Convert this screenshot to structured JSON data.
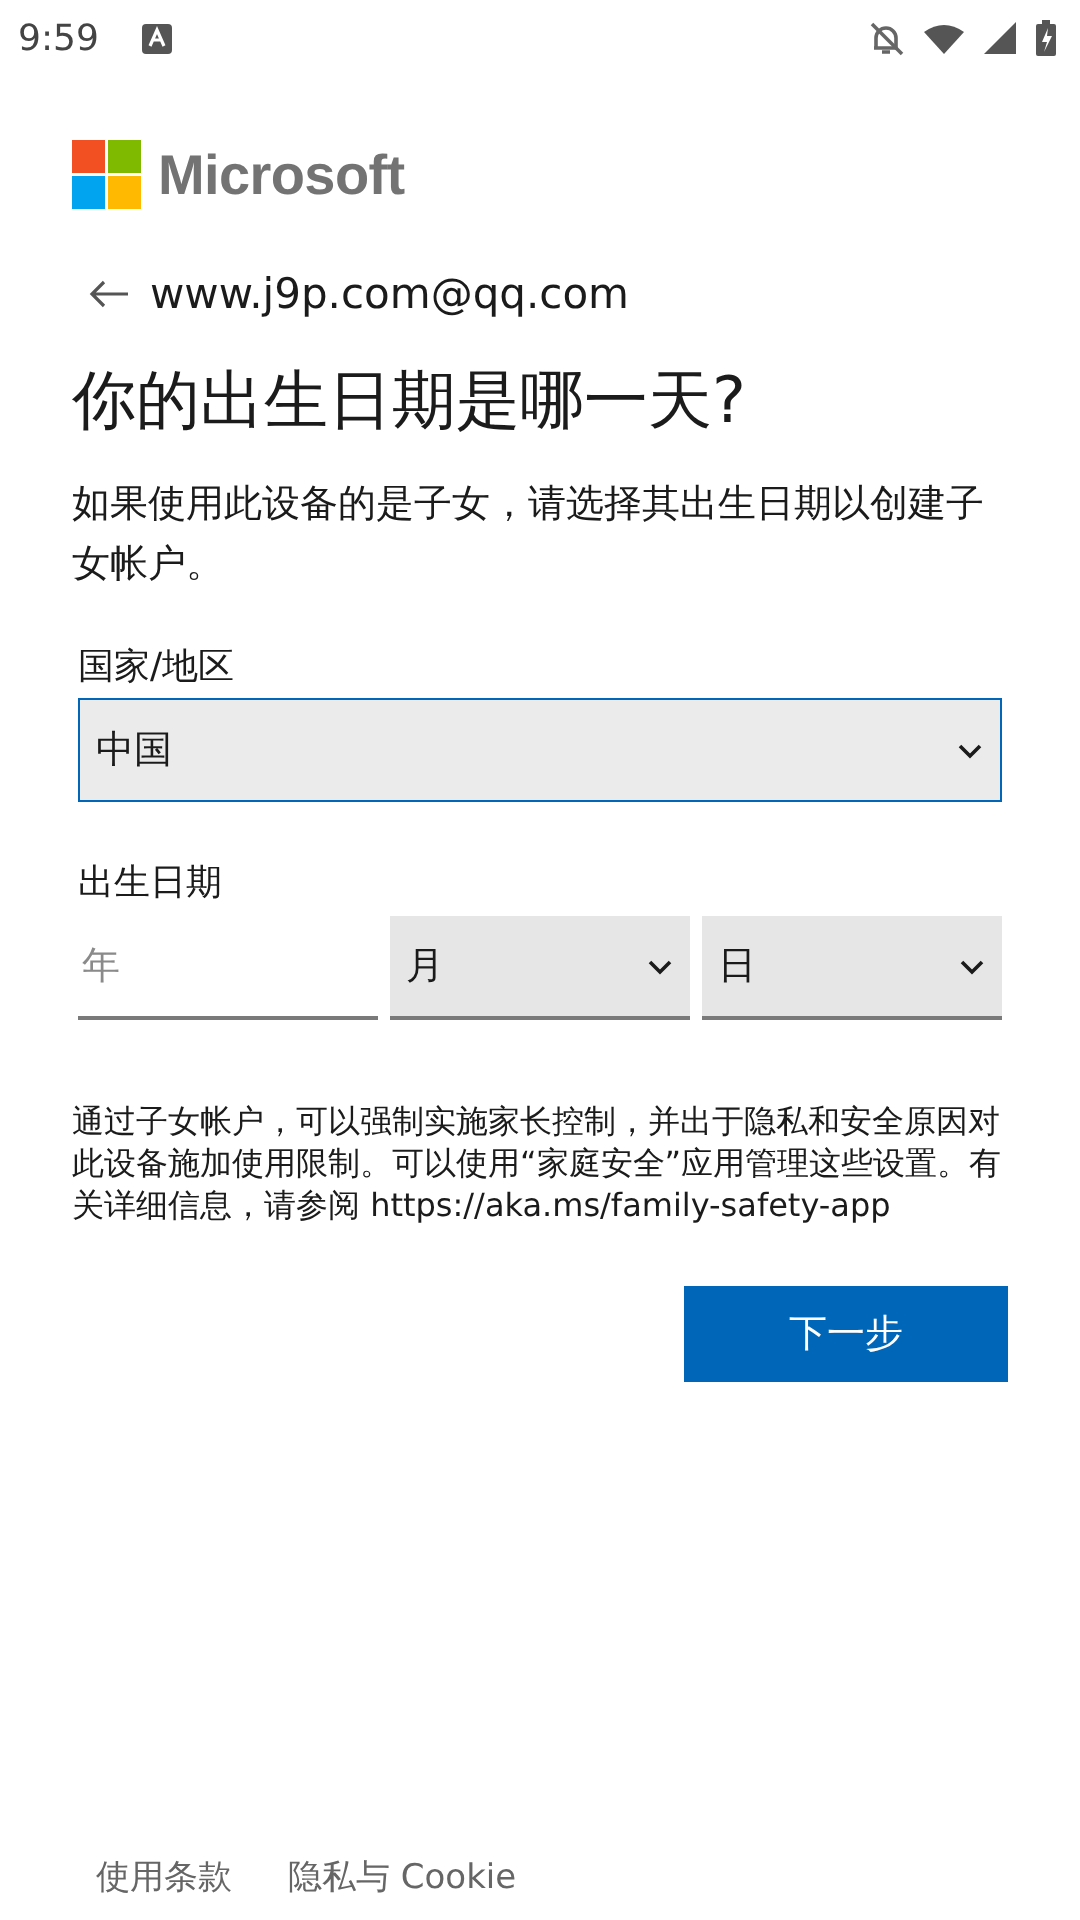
{
  "status_bar": {
    "time": "9:59"
  },
  "logo": {
    "text": "Microsoft"
  },
  "account": {
    "email": "www.j9p.com@qq.com"
  },
  "title": "你的出生日期是哪一天?",
  "description": "如果使用此设备的是子女，请选择其出生日期以创建子女帐户。",
  "country": {
    "label": "国家/地区",
    "value": "中国",
    "focused": true
  },
  "birthdate": {
    "label": "出生日期",
    "fields": [
      {
        "kind": "input",
        "placeholder": "年"
      },
      {
        "kind": "select",
        "value": "月"
      },
      {
        "kind": "select",
        "value": "日"
      }
    ]
  },
  "note": "通过子女帐户，可以强制实施家长控制，并出于隐私和安全原因对此设备施加使用限制。可以使用“家庭安全”应用管理这些设置。有关详细信息，请参阅 https://aka.ms/family-safety-app",
  "next_button": "下一步",
  "footer_links": [
    "使用条款",
    "隐私与 Cookie"
  ]
}
